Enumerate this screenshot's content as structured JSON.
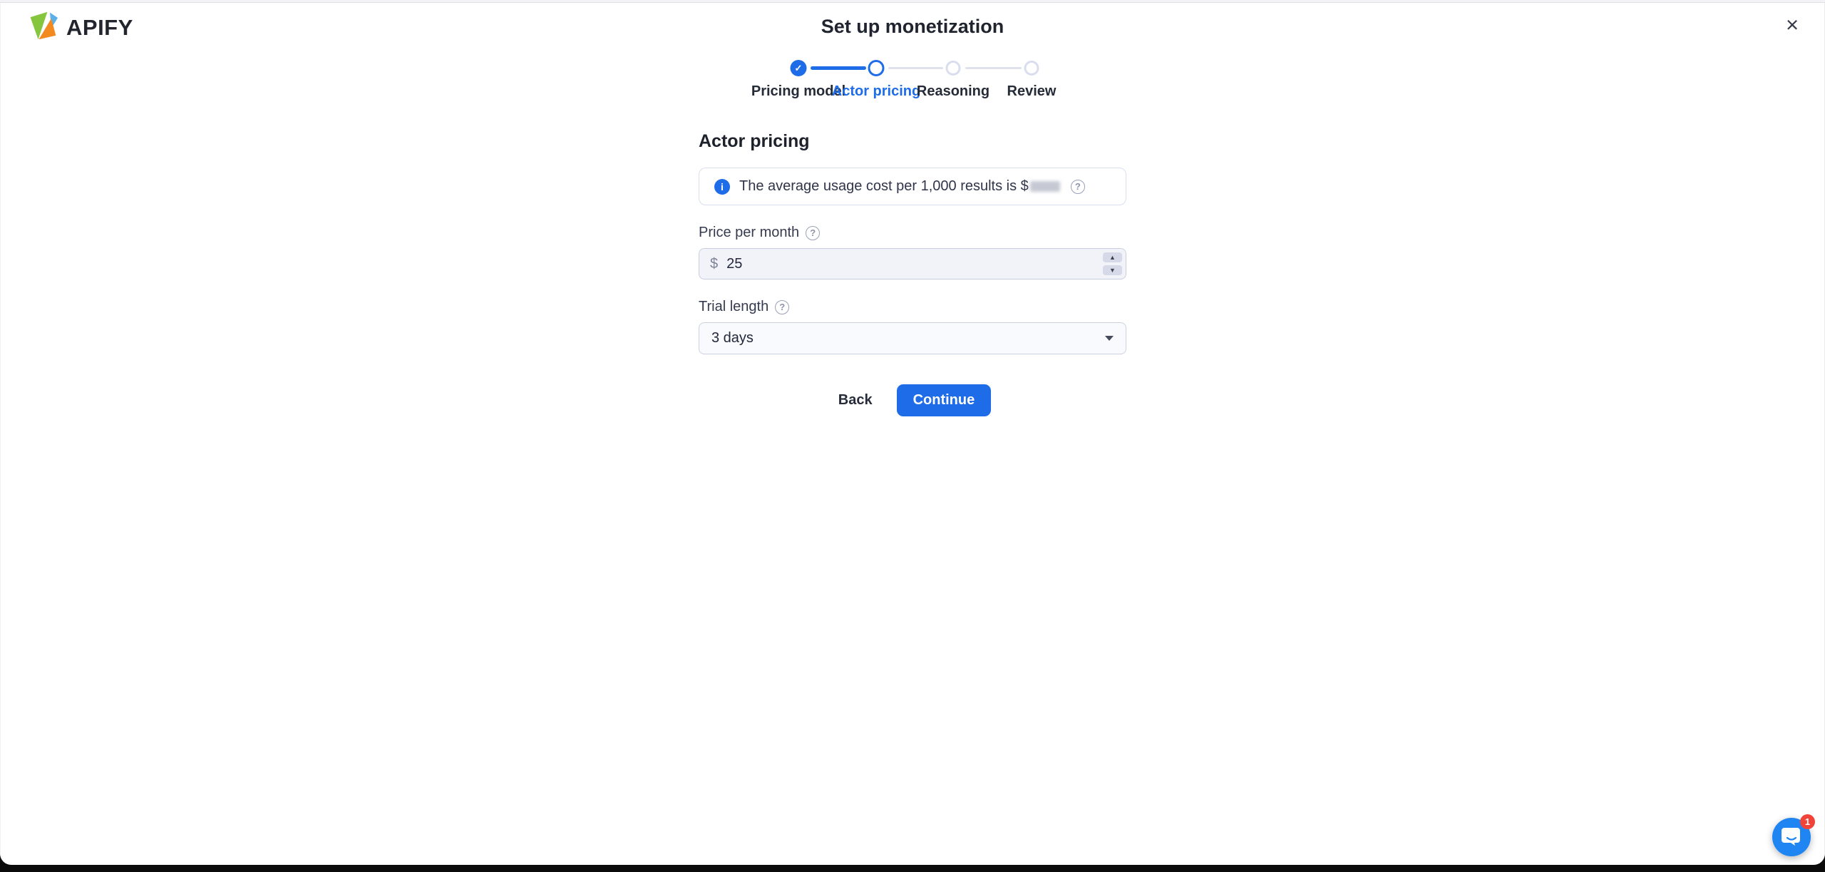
{
  "header": {
    "logo_text": "APIFY",
    "title": "Set up monetization",
    "close_glyph": "×"
  },
  "stepper": {
    "steps": [
      {
        "label": "Pricing model",
        "state": "completed"
      },
      {
        "label": "Actor pricing",
        "state": "active"
      },
      {
        "label": "Reasoning",
        "state": "upcoming"
      },
      {
        "label": "Review",
        "state": "upcoming"
      }
    ]
  },
  "content": {
    "heading": "Actor pricing",
    "info_banner": {
      "text": "The average usage cost per 1,000 results is $",
      "value_redacted": true
    },
    "price_field": {
      "label": "Price per month",
      "currency_prefix": "$",
      "value": "25"
    },
    "trial_field": {
      "label": "Trial length",
      "selected_option": "3 days"
    },
    "actions": {
      "back_label": "Back",
      "continue_label": "Continue"
    }
  },
  "chat": {
    "unread_count": "1"
  },
  "icons": {
    "check": "✓",
    "info": "i",
    "help": "?",
    "spin_up": "▲",
    "spin_down": "▼"
  },
  "colors": {
    "primary_blue": "#1e6ce8",
    "chat_blue": "#1e85f2",
    "badge_red": "#f0443b",
    "logo_green": "#86c53e",
    "logo_blue": "#5bb0ea",
    "logo_orange": "#f38a1f"
  }
}
